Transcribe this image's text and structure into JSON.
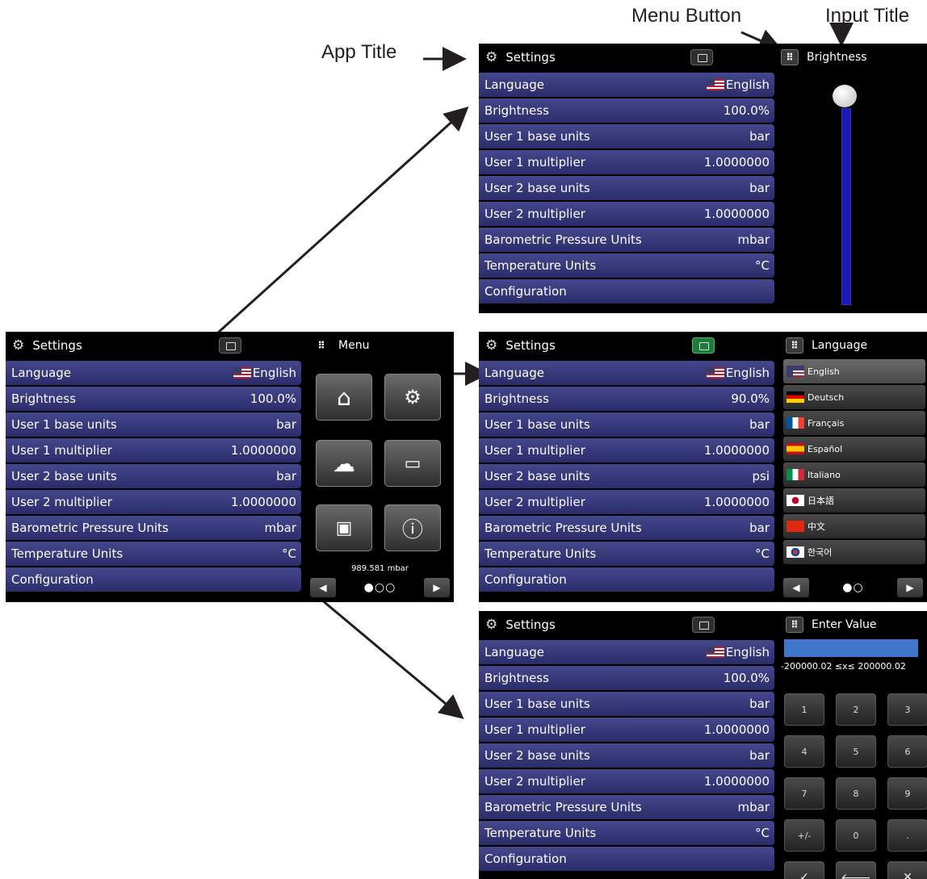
{
  "annotations": {
    "app_title": "App Title",
    "menu_button": "Menu Button",
    "input_title": "Input Title"
  },
  "app_title": "Settings",
  "settings_labels": [
    "Language",
    "Brightness",
    "User 1 base units",
    "User 1 multiplier",
    "User 2 base units",
    "User 2 multiplier",
    "Barometric Pressure Units",
    "Temperature Units",
    "Configuration"
  ],
  "screens": {
    "main": {
      "values": [
        "English",
        "100.0%",
        "bar",
        "1.0000000",
        "bar",
        "1.0000000",
        "mbar",
        "°C",
        ""
      ],
      "panel_title": "Menu",
      "pressure": "989.581 mbar",
      "page_dots": "●○○"
    },
    "brightness": {
      "values": [
        "English",
        "100.0%",
        "bar",
        "1.0000000",
        "bar",
        "1.0000000",
        "mbar",
        "°C",
        ""
      ],
      "panel_title": "Brightness",
      "brightness_level": 1.0
    },
    "language": {
      "values": [
        "English",
        "90.0%",
        "bar",
        "1.0000000",
        "psi",
        "1.0000000",
        "bar",
        "°C",
        ""
      ],
      "panel_title": "Language",
      "languages": [
        "English",
        "Deutsch",
        "Français",
        "Español",
        "Italiano",
        "日本語",
        "中文",
        "한국어"
      ],
      "page_dots": "●○"
    },
    "keypad": {
      "values": [
        "English",
        "100.0%",
        "bar",
        "1.0000000",
        "bar",
        "1.0000000",
        "mbar",
        "°C",
        ""
      ],
      "panel_title": "Enter Value",
      "range": "-200000.02 ≤x≤ 200000.02",
      "keys": [
        "1",
        "2",
        "3",
        "4",
        "5",
        "6",
        "7",
        "8",
        "9",
        "+/-",
        "0",
        ".",
        "✓",
        "🡐",
        "✕"
      ]
    }
  },
  "icons": {
    "menu_tiles": [
      "home-icon",
      "settings-icon",
      "cloud-icon",
      "display-settings-icon",
      "storage-icon",
      "info-icon"
    ]
  }
}
